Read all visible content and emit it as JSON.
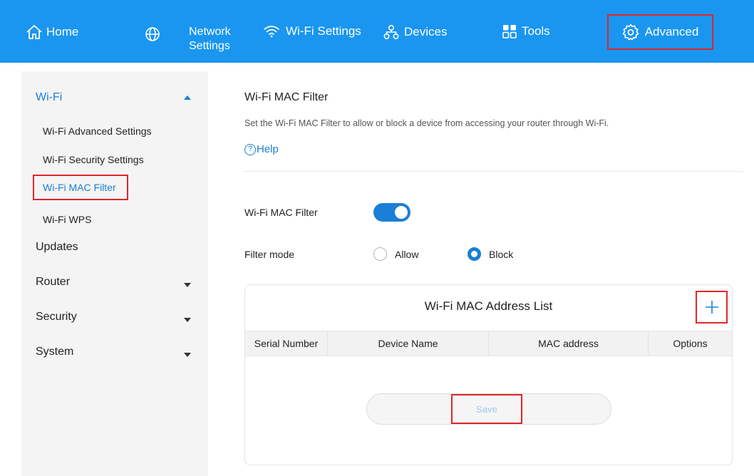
{
  "nav": {
    "home": "Home",
    "network_line1": "Network",
    "network_line2": "Settings",
    "wifi_settings": "Wi-Fi Settings",
    "devices": "Devices",
    "tools": "Tools",
    "advanced": "Advanced"
  },
  "sidebar": {
    "groups": [
      {
        "label": "Wi-Fi",
        "expanded": true
      },
      {
        "label": "Updates"
      },
      {
        "label": "Router"
      },
      {
        "label": "Security"
      },
      {
        "label": "System"
      }
    ],
    "wifi_items": [
      {
        "label": "Wi-Fi Advanced Settings"
      },
      {
        "label": "Wi-Fi Security Settings"
      },
      {
        "label": "Wi-Fi MAC Filter",
        "selected": true
      },
      {
        "label": "Wi-Fi WPS"
      }
    ]
  },
  "main": {
    "title": "Wi-Fi MAC Filter",
    "description": "Set the Wi-Fi MAC Filter to allow or block a device from accessing your router through Wi-Fi.",
    "help_label": "Help",
    "help_icon_glyph": "?",
    "filter_label": "Wi-Fi MAC Filter",
    "filter_enabled": true,
    "mode_label": "Filter mode",
    "mode_options": [
      "Allow",
      "Block"
    ],
    "mode_selected": "Block"
  },
  "mac_list": {
    "title": "Wi-Fi MAC Address List",
    "columns": [
      "Serial Number",
      "Device Name",
      "MAC address",
      "Options"
    ],
    "rows": [],
    "save_label": "Save"
  },
  "colors": {
    "header_blue": "#1a96f0",
    "accent_blue": "#1a7fd6",
    "highlight_red": "#e0262a"
  }
}
